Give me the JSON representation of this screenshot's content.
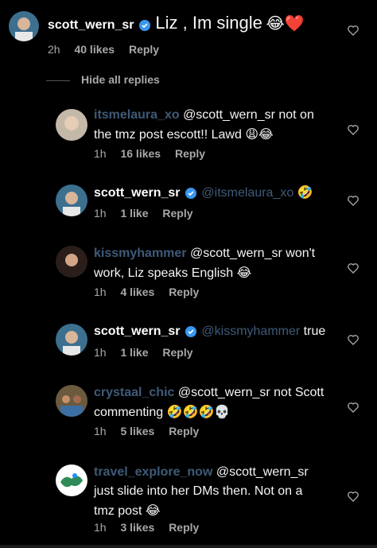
{
  "main_comment": {
    "username": "scott_wern_sr",
    "text": "Liz , Im single",
    "emoji": "😂❤️",
    "time": "2h",
    "likes": "40 likes",
    "reply": "Reply"
  },
  "hide_replies": "Hide all replies",
  "replies": [
    {
      "username": "itsmelaura_xo",
      "mention": "@scott_wern_sr",
      "text_line1": "not on",
      "text_line2": "the tmz post escott!! Lawd",
      "emoji": "😩😂",
      "time": "1h",
      "likes": "16 likes",
      "reply": "Reply"
    },
    {
      "username": "scott_wern_sr",
      "mention": "@itsmelaura_xo",
      "emoji": "🤣",
      "time": "1h",
      "likes": "1 like",
      "reply": "Reply"
    },
    {
      "username": "kissmyhammer",
      "mention": "@scott_wern_sr",
      "text_line1": "won't",
      "text_line2": "work, Liz speaks English",
      "emoji": "😂",
      "time": "1h",
      "likes": "4 likes",
      "reply": "Reply"
    },
    {
      "username": "scott_wern_sr",
      "mention": "@kissmyhammer",
      "text_line1": "true",
      "time": "1h",
      "likes": "1 like",
      "reply": "Reply"
    },
    {
      "username": "crystaal_chic",
      "mention": "@scott_wern_sr",
      "text_line1": "not Scott",
      "text_line2": "commenting",
      "emoji": "🤣🤣🤣💀",
      "time": "1h",
      "likes": "5 likes",
      "reply": "Reply"
    },
    {
      "username": "travel_explore_now",
      "mention": "@scott_wern_sr",
      "text_line2": "just slide into her DMs then. Not on a",
      "text_line3": "tmz post",
      "emoji": "😂",
      "time": "1h",
      "likes": "3 likes",
      "reply": "Reply"
    }
  ],
  "colors": {
    "background": "#000000",
    "meta": "#a8a8a8",
    "verified": "#3897f0",
    "obscured_username": "#3f5a78"
  }
}
